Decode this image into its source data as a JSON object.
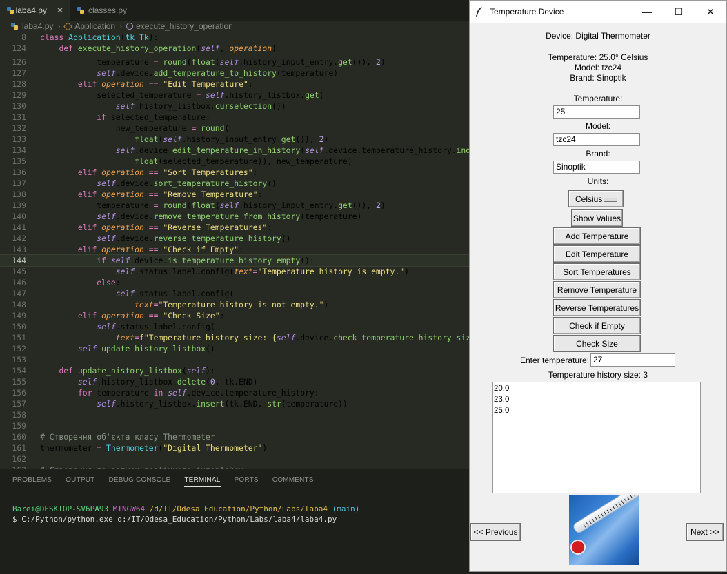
{
  "editor": {
    "tabs": [
      {
        "label": "laba4.py",
        "close": "✕"
      },
      {
        "label": "classes.py"
      }
    ],
    "breadcrumb": [
      "laba4.py",
      "Application",
      "execute_history_operation"
    ],
    "panel_tabs": [
      "PROBLEMS",
      "OUTPUT",
      "DEBUG CONSOLE",
      "TERMINAL",
      "PORTS",
      "COMMENTS"
    ],
    "terminal": {
      "user": "Barei@DESKTOP-SV6PA93",
      "env": "MINGW64",
      "path": "/d/IT/Odesa_Education/Python/Labs/laba4",
      "branch": "(main)",
      "command": "$ C:/Python/python.exe d:/IT/Odesa_Education/Python/Labs/laba4/laba4.py"
    },
    "current_line": "144"
  },
  "window": {
    "title": "Temperature Device",
    "controls": [
      "—",
      "☐",
      "✕"
    ],
    "device_label": "Device: Digital Thermometer",
    "info_lines": [
      "Temperature: 25.0° Celsius",
      "Model: tzc24",
      "Brand: Sinoptik"
    ],
    "temperature_label": "Temperature:",
    "temperature_value": "25",
    "model_label": "Model:",
    "model_value": "tzc24",
    "brand_label": "Brand:",
    "brand_value": "Sinoptik",
    "units_label": "Units:",
    "units_value": "Celsius",
    "show_values": "Show Values",
    "buttons": [
      "Add Temperature",
      "Edit Temperature",
      "Sort Temperatures",
      "Remove Temperature",
      "Reverse Temperatures",
      "Check if Empty",
      "Check Size"
    ],
    "enter_label": "Enter temperature:",
    "enter_value": "27",
    "history_size": "Temperature history size: 3",
    "history": [
      "20.0",
      "23.0",
      "25.0"
    ],
    "prev": "<< Previous",
    "next": "Next >>"
  }
}
